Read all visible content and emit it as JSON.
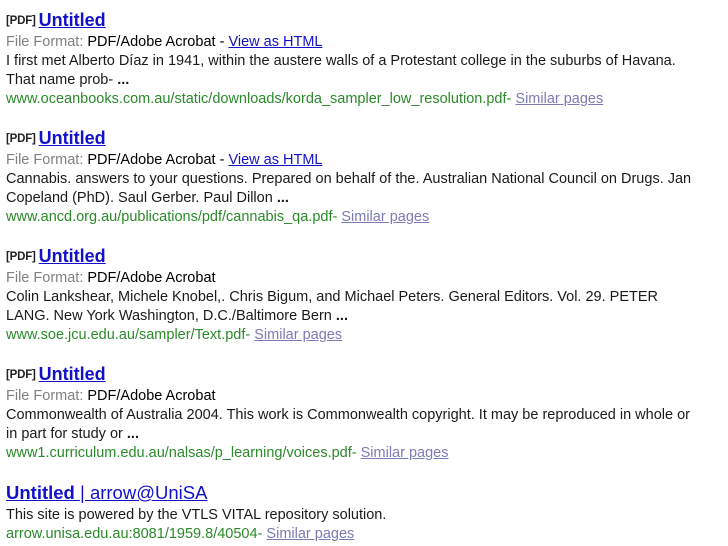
{
  "page": {
    "type": "search-results-list",
    "colors": {
      "background": "#ffffff",
      "title_link": "#1111cc",
      "url_green": "#2a8a2a",
      "similar_pages_link": "#7b7bb5",
      "file_format_label": "#808080",
      "snippet_text": "#1a1a1a"
    }
  },
  "labels": {
    "file_format_label": "File Format:",
    "separator": "-",
    "similar_pages": "Similar pages",
    "view_as_html": "View as HTML",
    "pdf_tag": "[PDF]"
  },
  "results": [
    {
      "filetype_tag": "[PDF]",
      "title": "Untitled",
      "title_tail": "",
      "file_format": "PDF/Adobe Acrobat",
      "view_as_html": "View as HTML",
      "snippet": "I first met Alberto Díaz in 1941, within the austere walls of a Protestant college in the suburbs of Havana. That name prob-",
      "snippet_ellipsis": "...",
      "url": "www.oceanbooks.com.au/static/downloads/korda_sampler_low_resolution.pdf",
      "similar_pages": "Similar pages"
    },
    {
      "filetype_tag": "[PDF]",
      "title": "Untitled",
      "title_tail": "",
      "file_format": "PDF/Adobe Acrobat",
      "view_as_html": "View as HTML",
      "snippet": "Cannabis. answers to your questions. Prepared on behalf of the. Australian National Council on Drugs. Jan Copeland (PhD). Saul Gerber. Paul Dillon",
      "snippet_ellipsis": "...",
      "url": "www.ancd.org.au/publications/pdf/cannabis_qa.pdf",
      "similar_pages": "Similar pages"
    },
    {
      "filetype_tag": "[PDF]",
      "title": "Untitled",
      "title_tail": "",
      "file_format": "PDF/Adobe Acrobat",
      "view_as_html": "",
      "snippet": "Colin Lankshear, Michele Knobel,. Chris Bigum, and Michael Peters. General Editors. Vol. 29. PETER LANG. New York Washington, D.C./Baltimore Bern",
      "snippet_ellipsis": "...",
      "url": "www.soe.jcu.edu.au/sampler/Text.pdf",
      "similar_pages": "Similar pages"
    },
    {
      "filetype_tag": "[PDF]",
      "title": "Untitled",
      "title_tail": "",
      "file_format": "PDF/Adobe Acrobat",
      "view_as_html": "",
      "snippet": "Commonwealth of Australia 2004. This work is Commonwealth copyright. It may be reproduced in whole or in part for study or",
      "snippet_ellipsis": "...",
      "url": "www1.curriculum.edu.au/nalsas/p_learning/voices.pdf",
      "similar_pages": "Similar pages"
    },
    {
      "filetype_tag": "",
      "title": "Untitled",
      "title_tail": " | arrow@UniSA",
      "file_format": "",
      "view_as_html": "",
      "snippet": "This site is powered by the VTLS VITAL repository solution.",
      "snippet_ellipsis": "",
      "url": "arrow.unisa.edu.au:8081/1959.8/40504",
      "similar_pages": "Similar pages"
    }
  ]
}
